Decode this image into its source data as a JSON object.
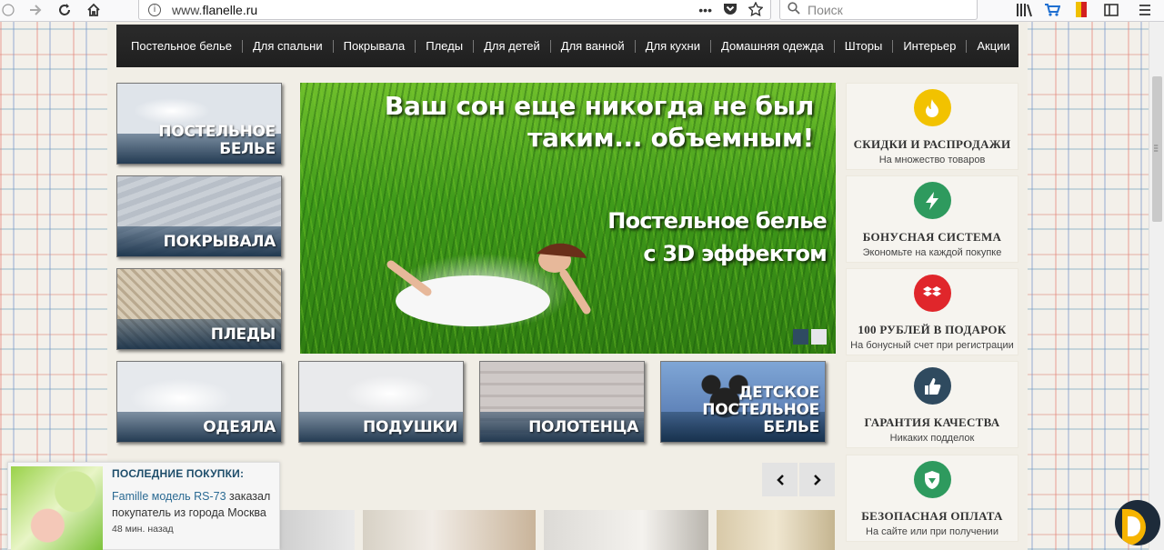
{
  "browser": {
    "url_prefix": "www.",
    "url_domain": "flanelle.ru",
    "search_placeholder": "Поиск",
    "icons": [
      "back-icon",
      "forward-icon",
      "reload-icon",
      "home-icon",
      "info-icon",
      "more-icon",
      "pocket-icon",
      "bookmark-star-icon",
      "search-icon",
      "library-icon",
      "cart-icon",
      "bookmark-flag-icon",
      "sidebar-icon",
      "menu-icon"
    ]
  },
  "nav": {
    "items": [
      "Постельное белье",
      "Для спальни",
      "Покрывала",
      "Пледы",
      "Для детей",
      "Для ванной",
      "Для кухни",
      "Домашняя одежда",
      "Шторы",
      "Интерьер",
      "Акции"
    ]
  },
  "tiles": {
    "bedding": "ПОСТЕЛЬНОЕ БЕЛЬЕ",
    "covers": "ПОКРЫВАЛА",
    "plaids": "ПЛЕДЫ",
    "blankets": "ОДЕЯЛА",
    "pillows": "ПОДУШКИ",
    "towels": "ПОЛОТЕНЦА",
    "kids_line1": "ДЕТСКОЕ",
    "kids_line2": "ПОСТЕЛЬНОЕ БЕЛЬЕ"
  },
  "banner": {
    "headline_line1": "Ваш сон еще никогда не был",
    "headline_line2": "таким... объемным!",
    "sub_line1": "Постельное белье",
    "sub_line2": "с 3D эффектом"
  },
  "features": [
    {
      "title": "СКИДКИ И РАСПРОДАЖИ",
      "subtitle": "На множество товаров",
      "icon": "fire-icon",
      "color": "#f2c200"
    },
    {
      "title": "БОНУСНАЯ СИСТЕМА",
      "subtitle": "Экономьте на каждой покупке",
      "icon": "lightning-icon",
      "color": "#2e9a5e"
    },
    {
      "title": "100 РУБЛЕЙ В ПОДАРОК",
      "subtitle": "На бонусный счет при регистрации",
      "icon": "gift-box-icon",
      "color": "#e0262b"
    },
    {
      "title": "ГАРАНТИЯ КАЧЕСТВА",
      "subtitle": "Никаких подделок",
      "icon": "thumbs-up-icon",
      "color": "#2f4a5f"
    },
    {
      "title": "БЕЗОПАСНАЯ ОПЛАТА",
      "subtitle": "На сайте или при получении",
      "icon": "shield-icon",
      "color": "#2e9a5e"
    }
  ],
  "carousel": {
    "prev": "‹",
    "next": "›"
  },
  "popup": {
    "title": "ПОСЛЕДНИЕ ПОКУПКИ:",
    "product_link": "Famille модель RS-73",
    "text_after": " заказал покупатель из города Москва",
    "time": "48 мин. назад"
  }
}
